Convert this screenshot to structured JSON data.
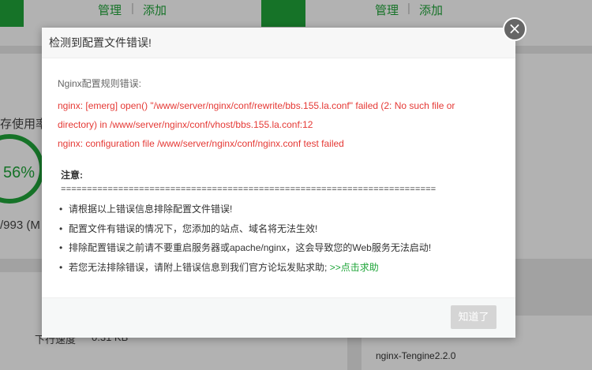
{
  "background": {
    "card_left": {
      "manage_label": "管理",
      "separator": "|",
      "add_label": "添加"
    },
    "card_right": {
      "manage_label": "管理",
      "separator": "|",
      "add_label": "添加"
    },
    "memory_label_partial": "存使用率",
    "gauge_value": "56%",
    "memory_detail_partial": "/993 (M",
    "download_speed_label_partial": "下行速度",
    "download_speed_value_partial": "0.31 KB",
    "software_name": "nginx-Tengine2.2.0"
  },
  "dialog": {
    "title": "检测到配置文件错误!",
    "close_glyph": "×",
    "error_heading": "Nginx配置规则错误:",
    "error_lines": [
      "nginx: [emerg] open() \"/www/server/nginx/conf/rewrite/bbs.155.la.conf\" failed (2: No such file or",
      "directory) in /www/server/nginx/conf/vhost/bbs.155.la.conf:12",
      "nginx: configuration file /www/server/nginx/conf/nginx.conf test failed"
    ],
    "note_heading": "注意:",
    "divider": "========================================================================",
    "notes": [
      "请根据以上错误信息排除配置文件错误!",
      "配置文件有错误的情况下，您添加的站点、域名将无法生效!",
      "排除配置错误之前请不要重启服务器或apache/nginx，这会导致您的Web服务无法启动!",
      "若您无法排除错误，请附上错误信息到我们官方论坛发贴求助;"
    ],
    "help_link": ">>点击求助",
    "ok_label": "知道了"
  },
  "colors": {
    "accent": "#20a53a",
    "error": "#e53935"
  }
}
